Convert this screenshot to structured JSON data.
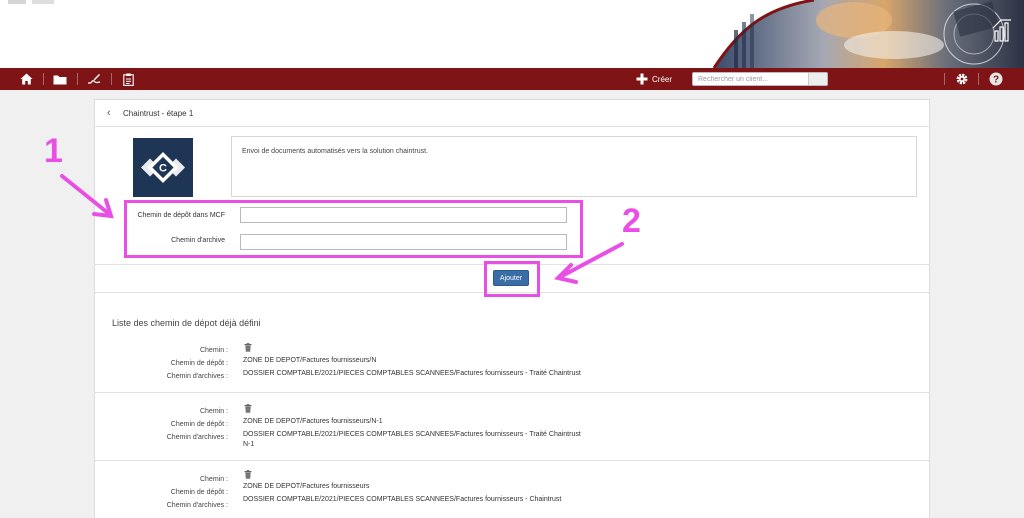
{
  "header": {
    "create_label": "Créer",
    "search_placeholder": "Rechercher un client..."
  },
  "icons": {
    "home": "home-icon",
    "folder": "folder-icon",
    "sign": "signature-icon",
    "clipboard": "clipboard-icon",
    "plus": "plus-icon",
    "settings": "gear-icon",
    "help": "help-icon",
    "back": "chevron-left-icon",
    "trash": "trash-icon"
  },
  "colors": {
    "navbar": "#7e1416",
    "button": "#3a6da5",
    "annotation": "#e94fe4",
    "logo": "#1e3556"
  },
  "page": {
    "title": "Chaintrust - étape 1",
    "description": "Envoi de documents automatisés vers la solution chaintrust.",
    "logo_letter": "C",
    "form": {
      "depot_label": "Chemin de dépôt dans MCF",
      "depot_value": "",
      "archive_label": "Chemin d'archive",
      "archive_value": ""
    },
    "add_button": "Ajouter",
    "list_title": "Liste des chemin de dépot déjà défini",
    "labels": {
      "chemin": "Chemin :",
      "depot": "Chemin de dépôt :",
      "archives": "Chemin d'archives :"
    },
    "entries": [
      {
        "depot": "ZONE DE DEPOT/Factures fournisseurs/N",
        "archive": "DOSSIER COMPTABLE/2021/PIECES COMPTABLES SCANNEES/Factures fournisseurs - Traité Chaintrust",
        "archive_line2": ""
      },
      {
        "depot": "ZONE DE DEPOT/Factures fournisseurs/N-1",
        "archive": "DOSSIER COMPTABLE/2021/PIECES COMPTABLES SCANNEES/Factures fournisseurs - Traité Chaintrust",
        "archive_line2": "N-1"
      },
      {
        "depot": "ZONE DE DEPOT/Factures fournisseurs",
        "archive": "DOSSIER COMPTABLE/2021/PIECES COMPTABLES SCANNEES/Factures fournisseurs - Chaintrust",
        "archive_line2": ""
      }
    ]
  },
  "annotations": {
    "one": "1",
    "two": "2"
  }
}
